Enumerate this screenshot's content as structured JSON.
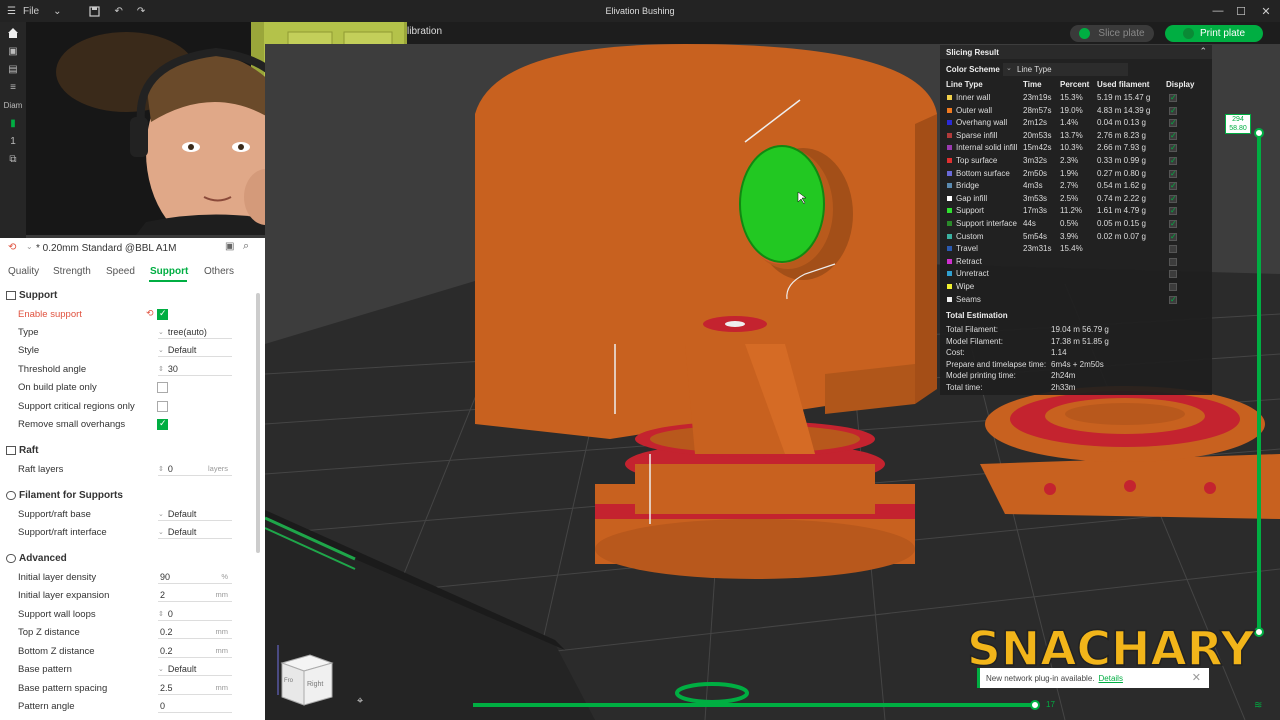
{
  "titlebar": {
    "file_label": "File",
    "window_title": "Elivation Bushing"
  },
  "tabbar": {
    "tab_partial": "libration",
    "slice_label": "Slice plate",
    "print_label": "Print plate"
  },
  "left_rail": {
    "partial_text_1": "Diam",
    "partial_text_2": "1"
  },
  "preset": {
    "name": "* 0.20mm Standard @BBL A1M"
  },
  "param_tabs": [
    {
      "label": "Quality"
    },
    {
      "label": "Strength"
    },
    {
      "label": "Speed"
    },
    {
      "label": "Support"
    },
    {
      "label": "Others"
    }
  ],
  "support": {
    "section": "Support",
    "enable_label": "Enable support",
    "type_label": "Type",
    "type_value": "tree(auto)",
    "style_label": "Style",
    "style_value": "Default",
    "threshold_label": "Threshold angle",
    "threshold_value": "30",
    "build_plate_label": "On build plate only",
    "critical_label": "Support critical regions only",
    "small_overhang_label": "Remove small overhangs"
  },
  "raft": {
    "section": "Raft",
    "layers_label": "Raft layers",
    "layers_value": "0",
    "layers_unit": "layers"
  },
  "filament_supports": {
    "section": "Filament for Supports",
    "base_label": "Support/raft base",
    "base_value": "Default",
    "interface_label": "Support/raft interface",
    "interface_value": "Default"
  },
  "advanced": {
    "section": "Advanced",
    "density_label": "Initial layer density",
    "density_value": "90",
    "density_unit": "%",
    "expansion_label": "Initial layer expansion",
    "expansion_value": "2",
    "expansion_unit": "mm",
    "wall_loops_label": "Support wall loops",
    "wall_loops_value": "0",
    "top_z_label": "Top Z distance",
    "top_z_value": "0.2",
    "top_z_unit": "mm",
    "bottom_z_label": "Bottom Z distance",
    "bottom_z_value": "0.2",
    "bottom_z_unit": "mm",
    "base_pattern_label": "Base pattern",
    "base_pattern_value": "Default",
    "base_spacing_label": "Base pattern spacing",
    "base_spacing_value": "2.5",
    "base_spacing_unit": "mm",
    "pattern_angle_label": "Pattern angle",
    "pattern_angle_value": "0"
  },
  "slicing_result": {
    "title": "Slicing Result",
    "color_scheme_label": "Color Scheme",
    "color_scheme_value": "Line Type",
    "headers": {
      "type": "Line Type",
      "time": "Time",
      "percent": "Percent",
      "used": "Used filament",
      "display": "Display"
    },
    "rows": [
      {
        "name": "Inner wall",
        "time": "23m19s",
        "percent": "15.3%",
        "used": "5.19 m  15.47 g",
        "color": "#f2d14a",
        "display": true
      },
      {
        "name": "Outer wall",
        "time": "28m57s",
        "percent": "19.0%",
        "used": "4.83 m  14.39 g",
        "color": "#f07a20",
        "display": true
      },
      {
        "name": "Overhang wall",
        "time": "2m12s",
        "percent": "1.4%",
        "used": "0.04 m  0.13 g",
        "color": "#2a2ad8",
        "display": true
      },
      {
        "name": "Sparse infill",
        "time": "20m53s",
        "percent": "13.7%",
        "used": "2.76 m  8.23 g",
        "color": "#b03a3a",
        "display": true
      },
      {
        "name": "Internal solid infill",
        "time": "15m42s",
        "percent": "10.3%",
        "used": "2.66 m  7.93 g",
        "color": "#9a3ab0",
        "display": true
      },
      {
        "name": "Top surface",
        "time": "3m32s",
        "percent": "2.3%",
        "used": "0.33 m  0.99 g",
        "color": "#e03030",
        "display": true
      },
      {
        "name": "Bottom surface",
        "time": "2m50s",
        "percent": "1.9%",
        "used": "0.27 m  0.80 g",
        "color": "#6a6ad8",
        "display": true
      },
      {
        "name": "Bridge",
        "time": "4m3s",
        "percent": "2.7%",
        "used": "0.54 m  1.62 g",
        "color": "#5a8ab0",
        "display": true
      },
      {
        "name": "Gap infill",
        "time": "3m53s",
        "percent": "2.5%",
        "used": "0.74 m  2.22 g",
        "color": "#ffffff",
        "display": true
      },
      {
        "name": "Support",
        "time": "17m3s",
        "percent": "11.2%",
        "used": "1.61 m  4.79 g",
        "color": "#30e030",
        "display": true
      },
      {
        "name": "Support interface",
        "time": "44s",
        "percent": "0.5%",
        "used": "0.05 m  0.15 g",
        "color": "#2a8a2a",
        "display": true
      },
      {
        "name": "Custom",
        "time": "5m54s",
        "percent": "3.9%",
        "used": "0.02 m  0.07 g",
        "color": "#3ab0a0",
        "display": true
      },
      {
        "name": "Travel",
        "time": "23m31s",
        "percent": "15.4%",
        "used": "",
        "color": "#2a5ab0",
        "display": false
      },
      {
        "name": "Retract",
        "time": "",
        "percent": "",
        "used": "",
        "color": "#d030d0",
        "display": false
      },
      {
        "name": "Unretract",
        "time": "",
        "percent": "",
        "used": "",
        "color": "#30a0d0",
        "display": false
      },
      {
        "name": "Wipe",
        "time": "",
        "percent": "",
        "used": "",
        "color": "#f0f030",
        "display": false
      },
      {
        "name": "Seams",
        "time": "",
        "percent": "",
        "used": "",
        "color": "#f0f0f0",
        "display": true
      }
    ],
    "total_title": "Total Estimation",
    "totals": [
      {
        "label": "Total Filament:",
        "value": "19.04 m    56.79 g"
      },
      {
        "label": "Model Filament:",
        "value": "17.38 m    51.85 g"
      },
      {
        "label": "Cost:",
        "value": "1.14"
      },
      {
        "label": "Prepare and timelapse time:",
        "value": "6m4s + 2m50s"
      },
      {
        "label": "Model printing time:",
        "value": "2h24m"
      },
      {
        "label": "Total time:",
        "value": "2h33m"
      }
    ]
  },
  "layer_slider": {
    "top_value": "294",
    "top_height": "58.80",
    "fill_fraction": 1.0
  },
  "move_slider": {
    "value": "17",
    "fill_fraction": 1.0
  },
  "view_cube": {
    "front": "Fro",
    "right": "Right"
  },
  "watermark": "SNACHARY",
  "notice": {
    "text": "New network plug-in available.",
    "link": "Details"
  },
  "colors": {
    "accent": "#00ae42",
    "model": "#c8611f",
    "support_color": "#22cc22"
  }
}
